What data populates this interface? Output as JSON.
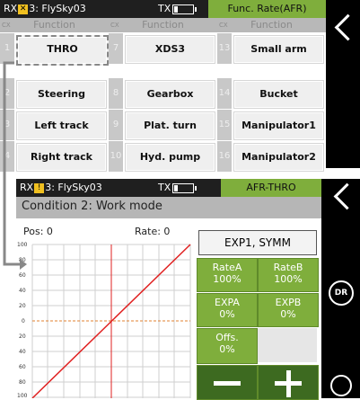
{
  "top_screen": {
    "status": {
      "rx": "RX",
      "channel": "3",
      "model": "FlySky03",
      "tx": "TX"
    },
    "title": "Func. Rate(AFR)",
    "header": {
      "cx": "CX",
      "function": "Function"
    },
    "rows": [
      [
        {
          "num": "1",
          "label": "THRO"
        },
        {
          "num": "7",
          "label": "XDS3"
        },
        {
          "num": "13",
          "label": "Small arm"
        }
      ],
      [
        {
          "num": "2",
          "label": "Steering"
        },
        {
          "num": "8",
          "label": "Gearbox"
        },
        {
          "num": "14",
          "label": "Bucket"
        }
      ],
      [
        {
          "num": "3",
          "label": "Left track"
        },
        {
          "num": "9",
          "label": "Plat. turn"
        },
        {
          "num": "15",
          "label": "Manipulator1"
        }
      ],
      [
        {
          "num": "4",
          "label": "Right track"
        },
        {
          "num": "10",
          "label": "Hyd. pump"
        },
        {
          "num": "16",
          "label": "Manipulator2"
        }
      ]
    ]
  },
  "bottom_screen": {
    "status": {
      "rx": "RX",
      "channel": "3",
      "model": "FlySky03",
      "tx": "TX"
    },
    "title": "AFR-THRO",
    "condition": "Condition 2:  Work mode",
    "pos_label": "Pos: 0",
    "rate_label": "Rate: 0",
    "exp_button": "EXP1, SYMM",
    "rate_a": {
      "label": "RateA",
      "value": "100%"
    },
    "rate_b": {
      "label": "RateB",
      "value": "100%"
    },
    "exp_a": {
      "label": "EXPA",
      "value": "0%"
    },
    "exp_b": {
      "label": "EXPB",
      "value": "0%"
    },
    "offs": {
      "label": "Offs.",
      "value": "0%"
    },
    "y_ticks": [
      "100",
      "80",
      "60",
      "40",
      "20",
      "0",
      "20",
      "40",
      "60",
      "80",
      "100"
    ],
    "dr_label": "DR"
  },
  "colors": {
    "accent_green": "#7fae3c",
    "dark_green": "#3d6a20",
    "curve": "#e02020"
  }
}
